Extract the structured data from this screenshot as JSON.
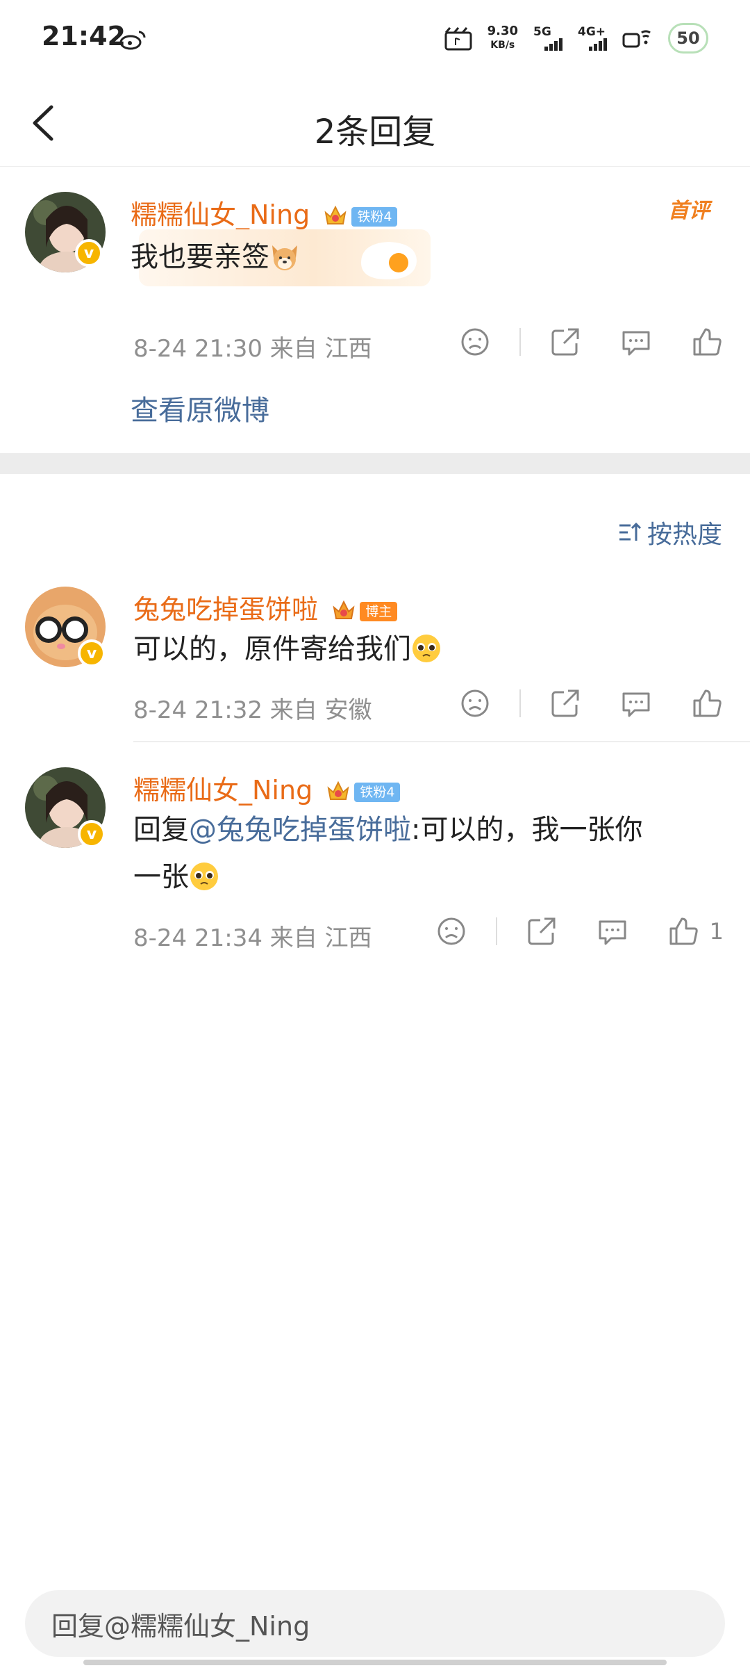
{
  "status_bar": {
    "time": "21:42",
    "net_speed_value": "9.30",
    "net_speed_unit": "KB/s",
    "sim1": "5G",
    "sim2": "4G+",
    "battery": "50"
  },
  "header": {
    "title": "2条回复"
  },
  "original": {
    "username": "糯糯仙女_Ning",
    "fan_badge": "铁粉4",
    "first_comment_label": "首评",
    "content": "我也要亲签",
    "meta": "8-24 21:30  来自 江西",
    "view_original": "查看原微博"
  },
  "sort": {
    "label": "按热度"
  },
  "replies": [
    {
      "username": "兔兔吃掉蛋饼啦",
      "badge": "博主",
      "content": "可以的，原件寄给我们",
      "meta": "8-24 21:32  来自 安徽",
      "likes": ""
    },
    {
      "username": "糯糯仙女_Ning",
      "badge": "铁粉4",
      "reply_prefix": "回复",
      "mention": "@兔兔吃掉蛋饼啦",
      "content_line1": ":可以的，我一张你",
      "content_line2": "一张",
      "meta": "8-24 21:34  来自 江西",
      "likes": "1"
    }
  ],
  "input": {
    "placeholder": "回复@糯糯仙女_Ning"
  },
  "colors": {
    "username_orange": "#e96b17",
    "link_blue": "#486c9a",
    "meta_gray": "#8f8f8f",
    "verified_yellow": "#f7b500"
  }
}
